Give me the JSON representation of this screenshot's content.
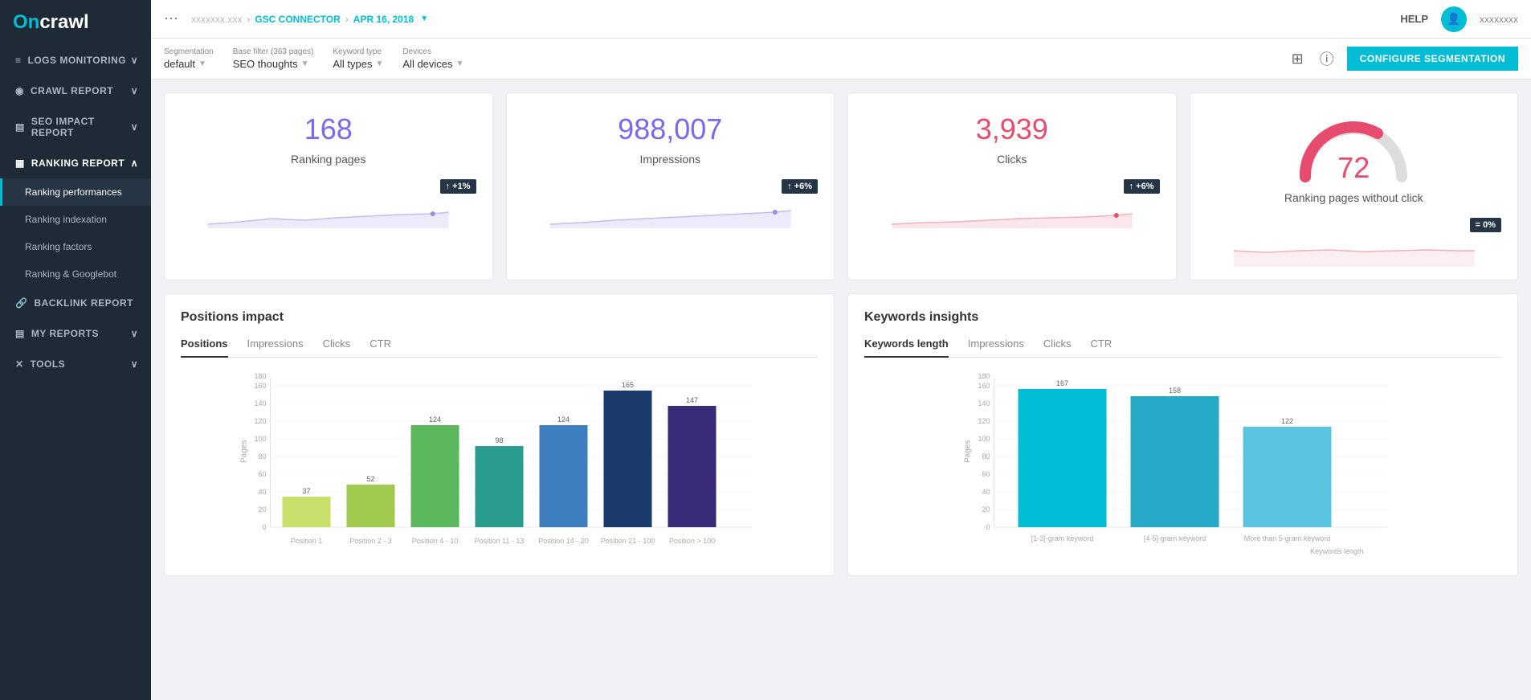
{
  "sidebar": {
    "logo": {
      "on": "On",
      "crawl": "crawl"
    },
    "items": [
      {
        "id": "logs",
        "label": "LOGS MONITORING",
        "icon": "☰",
        "expanded": true
      },
      {
        "id": "crawl",
        "label": "CRAWL REPORT",
        "icon": "◉",
        "expanded": true
      },
      {
        "id": "seo",
        "label": "SEO IMPACT REPORT",
        "icon": "▤",
        "expanded": true
      },
      {
        "id": "ranking",
        "label": "RANKING REPORT",
        "icon": "▦",
        "expanded": true
      },
      {
        "id": "backlink",
        "label": "BACKLINK REPORT",
        "icon": "🔗",
        "expanded": false
      },
      {
        "id": "reports",
        "label": "MY REPORTS",
        "icon": "▤",
        "expanded": false
      },
      {
        "id": "tools",
        "label": "TOOLS",
        "icon": "✕",
        "expanded": false
      }
    ],
    "sub_items": [
      {
        "id": "ranking-perf",
        "label": "Ranking performances",
        "active": true
      },
      {
        "id": "ranking-index",
        "label": "Ranking indexation",
        "active": false
      },
      {
        "id": "ranking-factors",
        "label": "Ranking factors",
        "active": false
      },
      {
        "id": "ranking-google",
        "label": "Ranking & Googlebot",
        "active": false
      }
    ]
  },
  "topbar": {
    "dots": "⋯",
    "breadcrumb": [
      {
        "label": "xxxxxxxx.xxx",
        "type": "blurred"
      },
      {
        "sep": "›"
      },
      {
        "label": "GSC CONNECTOR",
        "type": "link"
      },
      {
        "sep": "›"
      },
      {
        "label": "APR 16, 2018",
        "type": "dropdown"
      }
    ],
    "help": "HELP",
    "avatar_icon": "👤"
  },
  "filterbar": {
    "segmentation_label": "Segmentation",
    "segmentation_value": "default",
    "base_filter_label": "Base filter (363 pages)",
    "base_filter_value": "SEO thoughts",
    "keyword_type_label": "Keyword type",
    "keyword_type_value": "All types",
    "devices_label": "Devices",
    "devices_value": "All devices",
    "configure_btn": "CONFIGURE SEGMENTATION"
  },
  "kpis": [
    {
      "id": "ranking-pages",
      "value": "168",
      "label": "Ranking pages",
      "color": "#7b68ee",
      "trend": "↑ +1%",
      "trend_bg": "#263545"
    },
    {
      "id": "impressions",
      "value": "988,007",
      "label": "Impressions",
      "color": "#7b68ee",
      "trend": "↑ +6%",
      "trend_bg": "#263545"
    },
    {
      "id": "clicks",
      "value": "3,939",
      "label": "Clicks",
      "color": "#e74c6e",
      "trend": "↑ +6%",
      "trend_bg": "#263545"
    },
    {
      "id": "ranking-no-click",
      "value": "72",
      "label": "Ranking pages without click",
      "color": "#e74c6e",
      "trend": "= 0%",
      "trend_bg": "#263545",
      "is_gauge": true
    }
  ],
  "positions_chart": {
    "title": "Positions impact",
    "tabs": [
      "Positions",
      "Impressions",
      "Clicks",
      "CTR"
    ],
    "active_tab": "Positions",
    "y_label": "Pages",
    "bars": [
      {
        "label": "Position 1",
        "value": 37,
        "color": "#c8e06b"
      },
      {
        "label": "Position 2 - 3",
        "value": 52,
        "color": "#a0c94e"
      },
      {
        "label": "Position 4 - 10",
        "value": 124,
        "color": "#5cb85c"
      },
      {
        "label": "Position 11 - 13",
        "value": 98,
        "color": "#2a9d8f"
      },
      {
        "label": "Position 14 - 20",
        "value": 124,
        "color": "#3d7ebf"
      },
      {
        "label": "Position 21 - 100",
        "value": 165,
        "color": "#1a3a6b"
      },
      {
        "label": "Position > 100",
        "value": 147,
        "color": "#3a2a7a"
      }
    ],
    "y_max": 180,
    "y_ticks": [
      0,
      20,
      40,
      60,
      80,
      100,
      120,
      140,
      160,
      180
    ]
  },
  "keywords_chart": {
    "title": "Keywords insights",
    "tabs": [
      "Keywords length",
      "Impressions",
      "Clicks",
      "CTR"
    ],
    "active_tab": "Keywords length",
    "y_label": "Pages",
    "bars": [
      {
        "label": "[1-3]-gram keyword",
        "value": 167,
        "color": "#00bcd4"
      },
      {
        "label": "[4-5]-gram keyword",
        "value": 158,
        "color": "#26a9c8"
      },
      {
        "label": "More than 5-gram keyword",
        "value": 122,
        "color": "#5bc4e0"
      }
    ],
    "y_max": 180,
    "y_ticks": [
      0,
      20,
      40,
      60,
      80,
      100,
      120,
      140,
      160,
      180
    ],
    "x_label": "Keywords length"
  }
}
